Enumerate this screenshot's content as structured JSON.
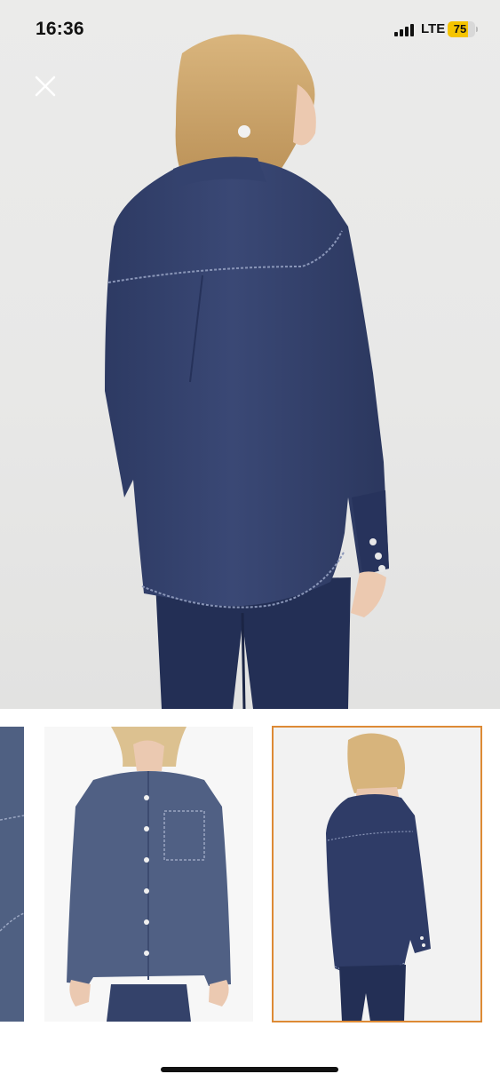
{
  "status_bar": {
    "time": "16:36",
    "network": "LTE",
    "battery_level": "75",
    "battery_fraction": 0.75,
    "battery_color": "#f5c400"
  },
  "viewer": {
    "close_icon": "close-icon",
    "main_image": "denim-shirt-back-view",
    "selected_thumbnail_index": 2
  },
  "gallery": {
    "thumbnails": [
      {
        "name": "denim-shirt-detail-partial"
      },
      {
        "name": "denim-shirt-front-view"
      },
      {
        "name": "denim-shirt-back-view"
      }
    ],
    "selected_border_color": "#dd8a35"
  },
  "colors": {
    "denim": "#2f3d68",
    "jeans": "#232f55",
    "background": "#e8e8e7"
  }
}
